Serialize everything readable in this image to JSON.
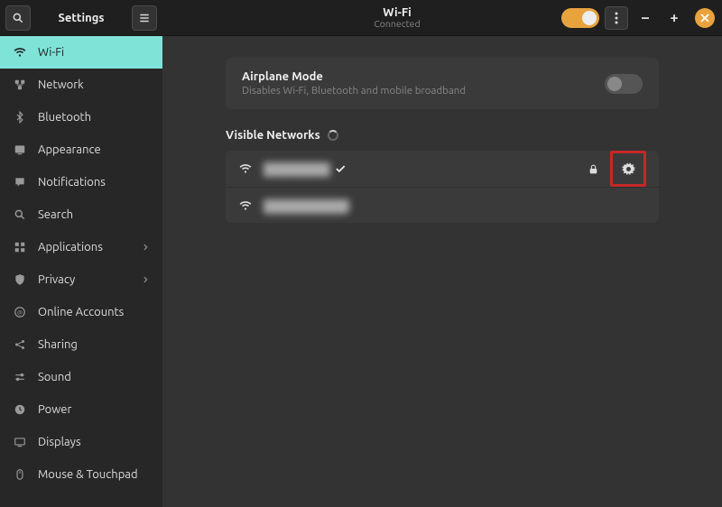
{
  "app": {
    "title": "Settings"
  },
  "sidebar": {
    "items": [
      {
        "label": "Wi-Fi",
        "icon": "wifi",
        "active": true
      },
      {
        "label": "Network",
        "icon": "network"
      },
      {
        "label": "Bluetooth",
        "icon": "bluetooth"
      },
      {
        "label": "Appearance",
        "icon": "appearance"
      },
      {
        "label": "Notifications",
        "icon": "notifications"
      },
      {
        "label": "Search",
        "icon": "search"
      },
      {
        "label": "Applications",
        "icon": "apps",
        "chevron": true
      },
      {
        "label": "Privacy",
        "icon": "privacy",
        "chevron": true
      },
      {
        "label": "Online Accounts",
        "icon": "online"
      },
      {
        "label": "Sharing",
        "icon": "sharing"
      },
      {
        "label": "Sound",
        "icon": "sound"
      },
      {
        "label": "Power",
        "icon": "power"
      },
      {
        "label": "Displays",
        "icon": "displays"
      },
      {
        "label": "Mouse & Touchpad",
        "icon": "mouse"
      }
    ]
  },
  "topbar": {
    "title": "Wi-Fi",
    "subtitle": "Connected",
    "wifi_enabled": true
  },
  "airplane": {
    "title": "Airplane Mode",
    "subtitle": "Disables Wi-Fi, Bluetooth and mobile broadband",
    "enabled": false
  },
  "networks": {
    "heading": "Visible Networks",
    "list": [
      {
        "ssid": "████████",
        "connected": true,
        "secured": true,
        "highlight_gear": true
      },
      {
        "ssid": "██████████",
        "connected": false,
        "secured": false
      }
    ]
  }
}
